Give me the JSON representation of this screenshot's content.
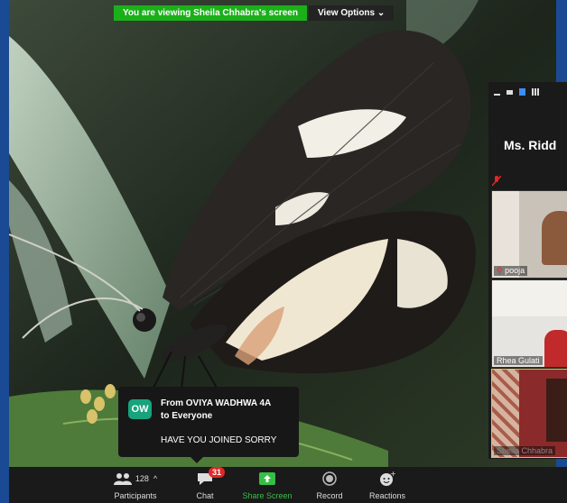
{
  "banner": {
    "viewing_text": "You are viewing Sheila Chhabra's screen",
    "view_options": "View Options ⌄"
  },
  "gallery": {
    "title": "Ms. Ridd",
    "tiles": [
      {
        "name": "pooja"
      },
      {
        "name": "Rhea Gulati"
      },
      {
        "name": "Sheila Chhabra"
      }
    ]
  },
  "notification": {
    "avatar_initials": "OW",
    "from_line1": "From OVIYA WADHWA 4A",
    "from_line2": "to Everyone",
    "message": "HAVE YOU JOINED SORRY"
  },
  "toolbar": {
    "participants_label": "Participants",
    "participants_count": "128",
    "chat_label": "Chat",
    "chat_badge": "31",
    "share_label": "Share Screen",
    "record_label": "Record",
    "reactions_label": "Reactions"
  },
  "colors": {
    "share_green": "#35c045",
    "banner_green": "#1bb01a",
    "badge_red": "#e02828",
    "frame_blue": "#1b4a94"
  }
}
